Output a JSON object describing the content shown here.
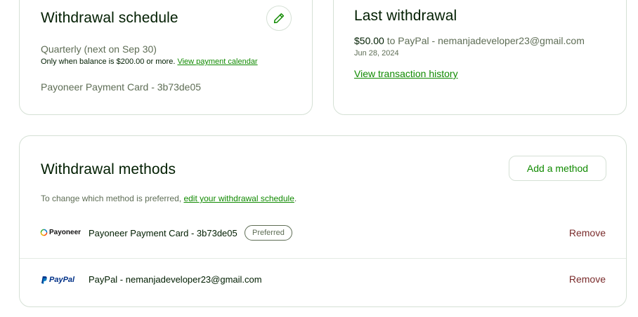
{
  "schedule": {
    "title": "Withdrawal schedule",
    "edit_icon": "pencil-icon",
    "frequency": "Quarterly (next on Sep 30)",
    "note_text": "Only when balance is $200.00 or more. ",
    "note_link": "View payment calendar",
    "method": "Payoneer Payment Card - 3b73de05"
  },
  "last_withdrawal": {
    "title": "Last withdrawal",
    "amount": "$50.00",
    "destination": "to PayPal - nemanjadeveloper23@gmail.com",
    "date": "Jun 28, 2024",
    "history_link": "View transaction history"
  },
  "methods": {
    "title": "Withdrawal methods",
    "add_button": "Add a method",
    "note_text": "To change which method is preferred, ",
    "note_link": "edit your withdrawal schedule",
    "note_end": ".",
    "items": [
      {
        "logo_text": "Payoneer",
        "name": "Payoneer Payment Card - 3b73de05",
        "badge": "Preferred",
        "remove": "Remove"
      },
      {
        "logo_text": "PayPal",
        "name": "PayPal - nemanjadeveloper23@gmail.com",
        "remove": "Remove"
      }
    ]
  },
  "colors": {
    "accent_green": "#108a00",
    "remove_red": "#7a2c2c",
    "muted_text": "#5e6d55",
    "border": "#d5e0d5"
  }
}
